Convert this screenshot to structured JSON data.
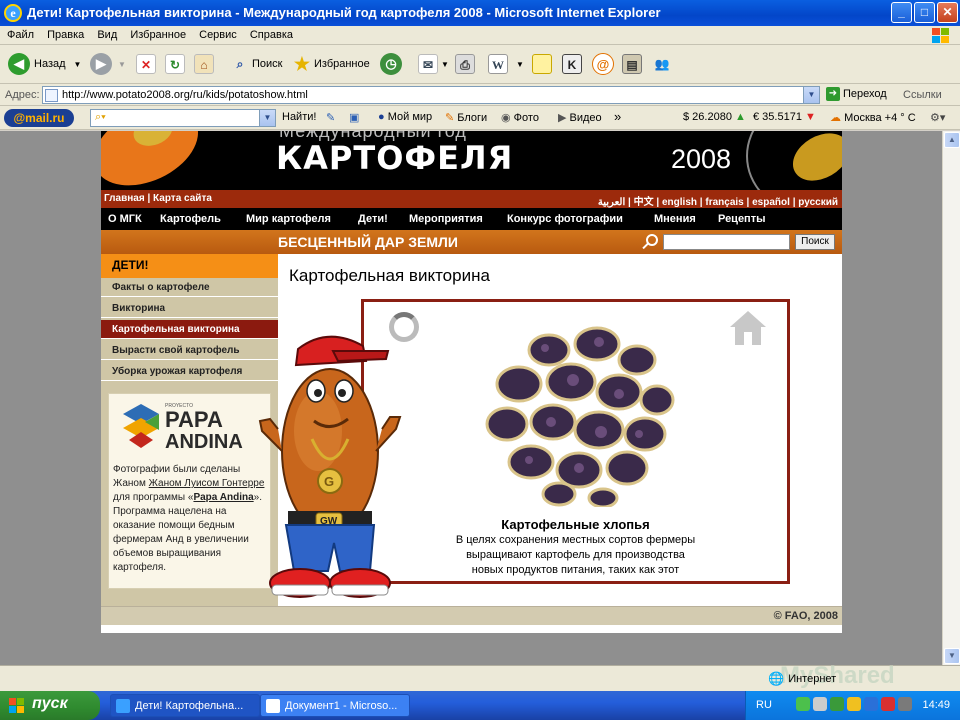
{
  "window": {
    "title": "Дети! Картофельная викторина - Международный год картофеля 2008 - Microsoft Internet Explorer",
    "minimize": "_",
    "maximize": "□",
    "close": "✕"
  },
  "menu": [
    "Файл",
    "Правка",
    "Вид",
    "Избранное",
    "Сервис",
    "Справка"
  ],
  "toolbar": {
    "back": "Назад",
    "search": "Поиск",
    "favorites": "Избранное"
  },
  "address": {
    "label": "Адрес:",
    "url": "http://www.potato2008.org/ru/kids/potatoshow.html",
    "go": "Переход",
    "links": "Ссылки"
  },
  "mailbar": {
    "logo": "@mail.ru",
    "find": "Найти!",
    "my_world": "Мой мир",
    "blogs": "Блоги",
    "photo": "Фото",
    "video": "Видео",
    "more": "»",
    "usd": "$ 26.2080",
    "eur": "€ 35.5171",
    "weather": "Москва +4 ° C"
  },
  "site": {
    "banner": {
      "top_text": "Международный год",
      "word": "КАРТОФЕЛЯ",
      "year": "2008"
    },
    "langbar": {
      "home": "Главная",
      "sep": "|",
      "sitemap": "Карта сайта",
      "arabic": "العربية",
      "chinese": "中文",
      "english": "english",
      "french": "français",
      "spanish": "español",
      "russian": "русский"
    },
    "nav": [
      "О МГК",
      "Картофель",
      "Мир картофеля",
      "Дети!",
      "Мероприятия",
      "Конкурс фотографии",
      "Мнения",
      "Рецепты"
    ],
    "subbar": {
      "title": "БЕСЦЕННЫЙ ДАР ЗЕМЛИ",
      "search_button": "Поиск"
    },
    "sidebar": {
      "head": "ДЕТИ!",
      "items": [
        "Факты о картофеле",
        "Викторина",
        "Картофельная викторина",
        "Вырасти свой картофель",
        "Уборка урожая картофеля"
      ],
      "active_index": 2,
      "logo_small": "PROYECTO",
      "logo_line1": "PAPA",
      "logo_line2": "ANDINA",
      "credit_1": "Фотографии были сделаны Жаном ",
      "credit_name": "Жаном Луисом Гонтерре",
      "credit_2": " для программы «",
      "credit_program": "Papa Andina",
      "credit_3": "». Программа нацелена на оказание помощи бедным фермерам Анд в увеличении объемов выращивания картофеля."
    },
    "main": {
      "title": "Картофельная викторина",
      "caption": "Картофельные хлопья",
      "description_1": "В целях сохранения местных сортов фермеры",
      "description_2": "выращивают картофель для производства",
      "description_3": "новых продуктов питания, таких как этот"
    },
    "footer": "© FAO, 2008"
  },
  "status": {
    "zone": "Интернет",
    "watermark": "MyShared"
  },
  "taskbar": {
    "start": "пуск",
    "tasks": [
      "Дети! Картофельна...",
      "Документ1 - Microso..."
    ],
    "lang": "RU",
    "time": "14:49"
  }
}
